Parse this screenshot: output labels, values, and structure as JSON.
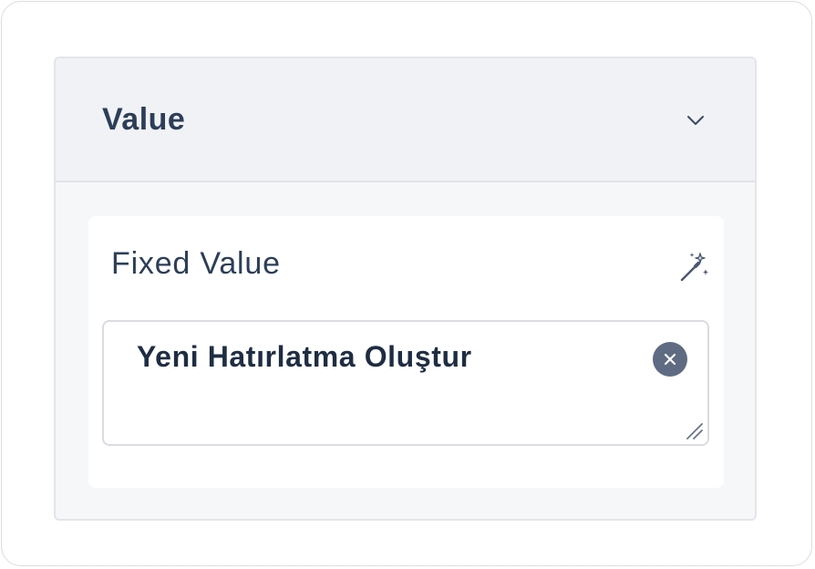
{
  "section": {
    "title": "Value",
    "expanded": true,
    "toggle_icon": "chevron-down-icon"
  },
  "field": {
    "label": "Fixed Value",
    "action_icon": "magic-wand-icon",
    "value": "Yeni Hatırlatma Oluştur",
    "clear_icon": "close-circle-icon",
    "resize_icon": "resize-handle-icon"
  },
  "colors": {
    "title_text": "#2c3e58",
    "value_text": "#1f2d43",
    "header_bg": "#f1f2f5",
    "clear_button": "#5e6b82",
    "border": "#e3e5ea"
  }
}
